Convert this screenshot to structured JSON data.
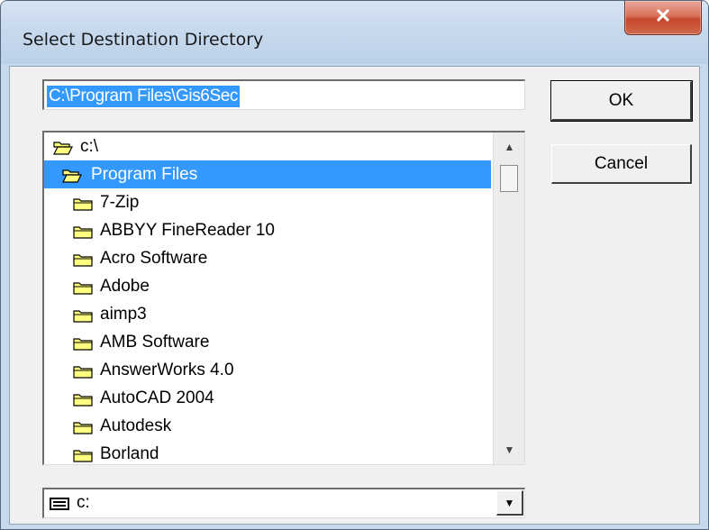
{
  "window": {
    "title": "Select Destination Directory",
    "close_glyph": "✕"
  },
  "path": {
    "value": "C:\\Program Files\\Gis6Sec"
  },
  "buttons": {
    "ok": "OK",
    "cancel": "Cancel"
  },
  "directories": [
    {
      "name": "c:\\",
      "icon": "open-folder-icon",
      "selected": false
    },
    {
      "name": "Program Files",
      "icon": "open-folder-icon",
      "selected": true
    },
    {
      "name": "7-Zip",
      "icon": "folder-icon",
      "selected": false
    },
    {
      "name": "ABBYY FineReader 10",
      "icon": "folder-icon",
      "selected": false
    },
    {
      "name": "Acro Software",
      "icon": "folder-icon",
      "selected": false
    },
    {
      "name": "Adobe",
      "icon": "folder-icon",
      "selected": false
    },
    {
      "name": "aimp3",
      "icon": "folder-icon",
      "selected": false
    },
    {
      "name": "AMB Software",
      "icon": "folder-icon",
      "selected": false
    },
    {
      "name": "AnswerWorks 4.0",
      "icon": "folder-icon",
      "selected": false
    },
    {
      "name": "AutoCAD 2004",
      "icon": "folder-icon",
      "selected": false
    },
    {
      "name": "Autodesk",
      "icon": "folder-icon",
      "selected": false
    },
    {
      "name": "Borland",
      "icon": "folder-icon",
      "selected": false
    }
  ],
  "drive": {
    "value": "c:",
    "icon": "drive-icon"
  },
  "scrollbar": {
    "up_glyph": "▲",
    "down_glyph": "▼"
  },
  "colors": {
    "selection": "#3399ff",
    "folder_fill": "#ffff80",
    "titlebar": "#c6d8ec",
    "close_button": "#c5462d"
  }
}
